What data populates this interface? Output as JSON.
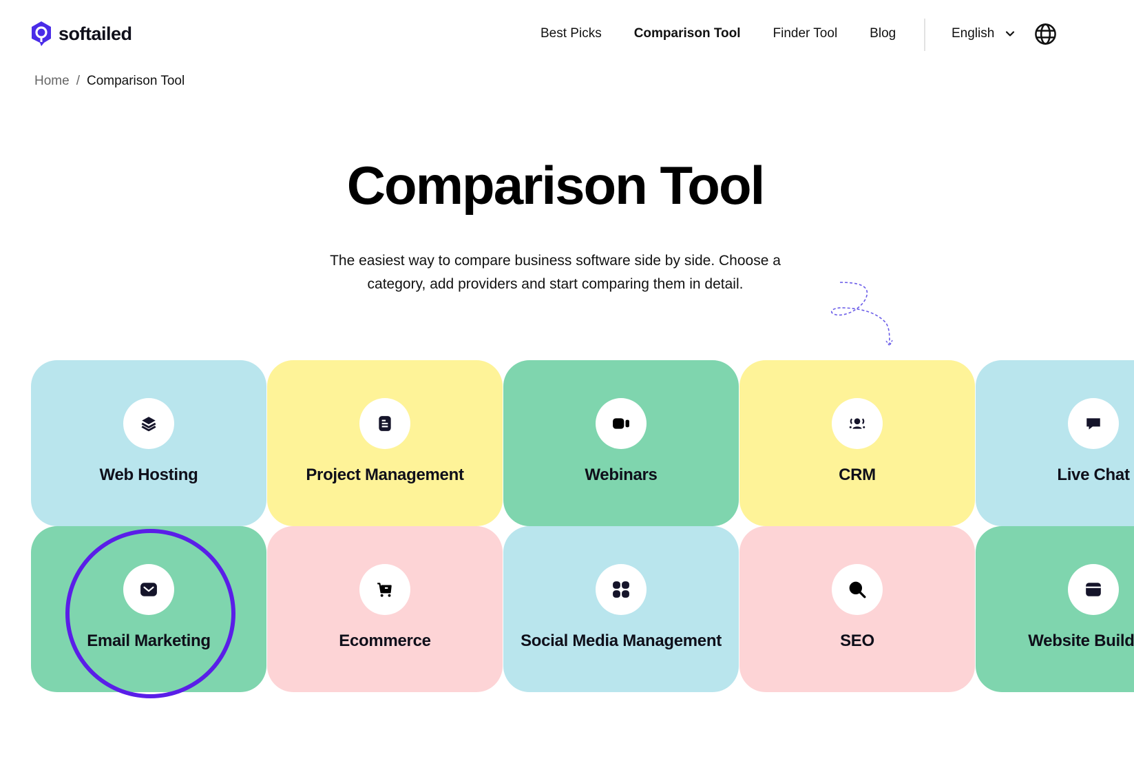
{
  "brand": {
    "name": "softailed",
    "accent": "#4a2ce8"
  },
  "nav": {
    "items": [
      {
        "label": "Best Picks",
        "active": false
      },
      {
        "label": "Comparison Tool",
        "active": true
      },
      {
        "label": "Finder Tool",
        "active": false
      },
      {
        "label": "Blog",
        "active": false
      }
    ],
    "language": "English",
    "language_icon": "chevron-down-icon",
    "globe_icon": "globe-icon"
  },
  "breadcrumb": {
    "home": "Home",
    "separator": "/",
    "current": "Comparison Tool"
  },
  "hero": {
    "title": "Comparison Tool",
    "subtitle_line1": "The easiest way to compare business software side by side. Choose a",
    "subtitle_line2": "category, add providers and start comparing them in detail."
  },
  "categories": [
    {
      "label": "Web Hosting",
      "icon": "layers-icon",
      "color": "#b9e5ed"
    },
    {
      "label": "Project Management",
      "icon": "document-icon",
      "color": "#fef398"
    },
    {
      "label": "Webinars",
      "icon": "video-camera-icon",
      "color": "#7fd5ae"
    },
    {
      "label": "CRM",
      "icon": "users-icon",
      "color": "#fef398"
    },
    {
      "label": "Live Chat",
      "icon": "chat-icon",
      "color": "#b9e5ed"
    },
    {
      "label": "Email Marketing",
      "icon": "envelope-icon",
      "color": "#7fd5ae",
      "highlighted": true
    },
    {
      "label": "Ecommerce",
      "icon": "shopping-cart-icon",
      "color": "#fdd4d6"
    },
    {
      "label": "Social Media Management",
      "icon": "grid-icon",
      "color": "#b9e5ed"
    },
    {
      "label": "SEO",
      "icon": "magnifier-icon",
      "color": "#fdd4d6"
    },
    {
      "label": "Website Builders",
      "icon": "browser-icon",
      "color": "#7fd5ae"
    }
  ]
}
